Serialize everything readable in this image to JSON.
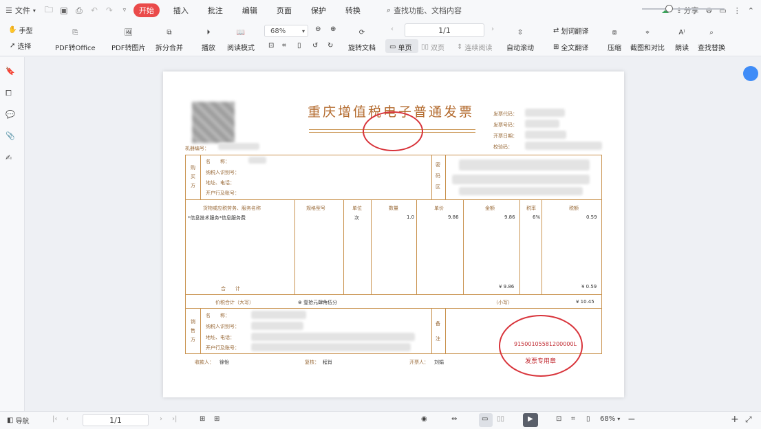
{
  "menubar": {
    "file_menu": "文件",
    "tabs": [
      {
        "label": "开始",
        "active": true
      },
      {
        "label": "插入",
        "active": false
      },
      {
        "label": "批注",
        "active": false
      },
      {
        "label": "编辑",
        "active": false
      },
      {
        "label": "页面",
        "active": false
      },
      {
        "label": "保护",
        "active": false
      },
      {
        "label": "转换",
        "active": false
      }
    ],
    "search_label": "查找功能、文档内容",
    "share_label": "分享"
  },
  "ribbon": {
    "hand_tool": "手型",
    "select_tool": "选择",
    "pdf_to_office": "PDF转Office",
    "pdf_to_image": "PDF转图片",
    "split_merge": "拆分合并",
    "play": "播放",
    "read_mode": "阅读模式",
    "zoom_value": "68%",
    "rotate_doc": "旋转文档",
    "page_indicator": "1/1",
    "single_page": "单页",
    "double_page": "双页",
    "continuous_read": "连续阅读",
    "auto_scroll": "自动滚动",
    "translate": "划词翻译",
    "full_translate": "全文翻译",
    "compress": "压缩",
    "screenshot_compare": "截图和对比",
    "read_aloud": "朗读",
    "find_replace": "查找替换"
  },
  "invoice": {
    "title": "重庆增值税电子普通发票",
    "code_labels": [
      "发票代码：",
      "发票号码：",
      "开票日期：",
      "校验码："
    ],
    "machine_no_label": "机器编号：",
    "buyer_side_label": "购买方",
    "buyer_fields": [
      "名　　称：",
      "纳税人识别号：",
      "地址、电话：",
      "开户行及账号："
    ],
    "password_area_label": "密码区",
    "columns": [
      "货物或应税劳务、服务名称",
      "规格型号",
      "单位",
      "数量",
      "单价",
      "金额",
      "税率",
      "税额"
    ],
    "item": {
      "name": "*信息技术服务*信息服务费",
      "unit": "次",
      "quantity": "1.0",
      "unit_price": "9.86",
      "amount": "9.86",
      "tax_rate": "6%",
      "tax": "0.59"
    },
    "subtotal_label": "合　　计",
    "subtotal_amount": "¥ 9.86",
    "subtotal_tax": "¥ 0.59",
    "total_words_label": "价税合计（大写）",
    "total_words_value": "⊗ 壹拾元肆角伍分",
    "total_small_label": "（小写）",
    "total_small_value": "¥ 10.45",
    "seller_side_label": "销售方",
    "seller_fields": [
      "名　　称：",
      "纳税人识别号：",
      "地址、电话：",
      "开户行及账号："
    ],
    "remark_label": "备注",
    "payee_label": "收款人：",
    "payee_value": "徐怡",
    "reviewer_label": "复核：",
    "reviewer_value": "程肖",
    "drawer_label": "开票人：",
    "drawer_value": "刘娟",
    "seller_stamp_number": "91500105581200000L",
    "seller_stamp_label": "发票专用章"
  },
  "statusbar": {
    "nav_label": "导航",
    "page_indicator": "1/1",
    "zoom_value": "68%"
  }
}
